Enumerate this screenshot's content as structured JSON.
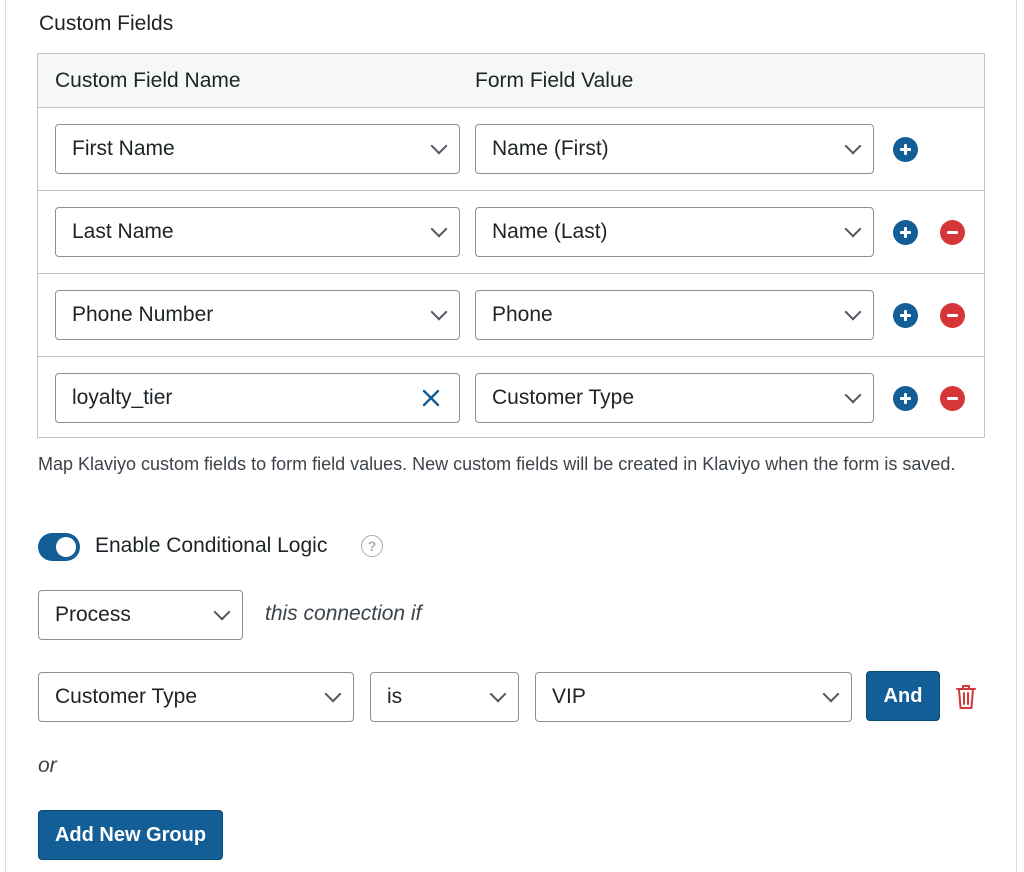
{
  "custom_fields": {
    "title": "Custom Fields",
    "headers": {
      "name": "Custom Field Name",
      "value": "Form Field Value"
    },
    "rows": [
      {
        "name": "First Name",
        "value": "Name (First)",
        "removable": false,
        "name_is_text": false
      },
      {
        "name": "Last Name",
        "value": "Name (Last)",
        "removable": true,
        "name_is_text": false
      },
      {
        "name": "Phone Number",
        "value": "Phone",
        "removable": true,
        "name_is_text": false
      },
      {
        "name": "loyalty_tier",
        "value": "Customer Type",
        "removable": true,
        "name_is_text": true
      }
    ],
    "help_text": "Map Klaviyo custom fields to form field values. New custom fields will be created in Klaviyo when the form is saved."
  },
  "conditional_logic": {
    "enabled": true,
    "toggle_label": "Enable Conditional Logic",
    "help_glyph": "?",
    "action": "Process",
    "action_suffix": "this connection if",
    "rule": {
      "field": "Customer Type",
      "operator": "is",
      "value": "VIP"
    },
    "and_label": "And",
    "or_label": "or",
    "add_group_label": "Add New Group"
  },
  "colors": {
    "primary": "#135e96",
    "danger": "#d63638",
    "border": "#c3c4c7",
    "header_bg": "#f6f7f7"
  }
}
